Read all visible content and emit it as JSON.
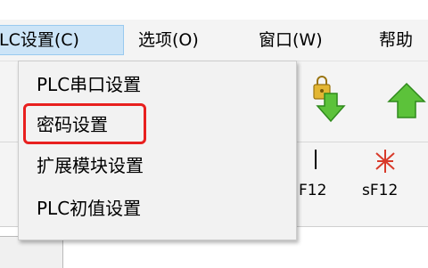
{
  "menubar": {
    "items": [
      {
        "label": "LC设置(C)",
        "active": true
      },
      {
        "label": "选项(O)"
      },
      {
        "label": "窗口(W)"
      },
      {
        "label": "帮助"
      }
    ]
  },
  "dropdown": {
    "items": [
      {
        "label": "PLC串口设置"
      },
      {
        "label": "密码设置",
        "highlighted": true
      },
      {
        "label": "扩展模块设置"
      },
      {
        "label": "PLC初值设置"
      }
    ]
  },
  "toolbar": {
    "icons": [
      "lock-download-icon",
      "upload-arrow-icon"
    ],
    "labels": [
      {
        "label": "F12"
      },
      {
        "label": "sF12"
      }
    ]
  },
  "colors": {
    "highlight_border": "#e8201f",
    "active_menu_bg": "#cce4f7",
    "green_arrow": "#5cc23a"
  }
}
